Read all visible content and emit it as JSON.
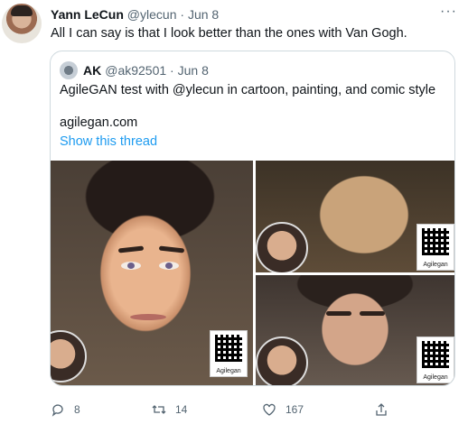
{
  "author": {
    "name": "Yann LeCun",
    "handle": "@ylecun",
    "date": "Jun 8"
  },
  "tweet_text": "All I can say is that I look better than the ones with Van Gogh.",
  "more_label": "···",
  "quote": {
    "name": "AK",
    "handle": "@ak92501",
    "date": "Jun 8",
    "text": "AgileGAN test with @ylecun in cartoon, painting, and comic style",
    "link": "agilegan.com",
    "show_thread": "Show this thread",
    "watermark": "Agilegan"
  },
  "actions": {
    "replies": "8",
    "retweets": "14",
    "likes": "167"
  },
  "icons": [
    "reply-icon",
    "retweet-icon",
    "like-icon",
    "share-icon",
    "more-icon"
  ],
  "colors": {
    "link": "#1d9bf0",
    "muted": "#536471",
    "border": "#cfd9de"
  }
}
